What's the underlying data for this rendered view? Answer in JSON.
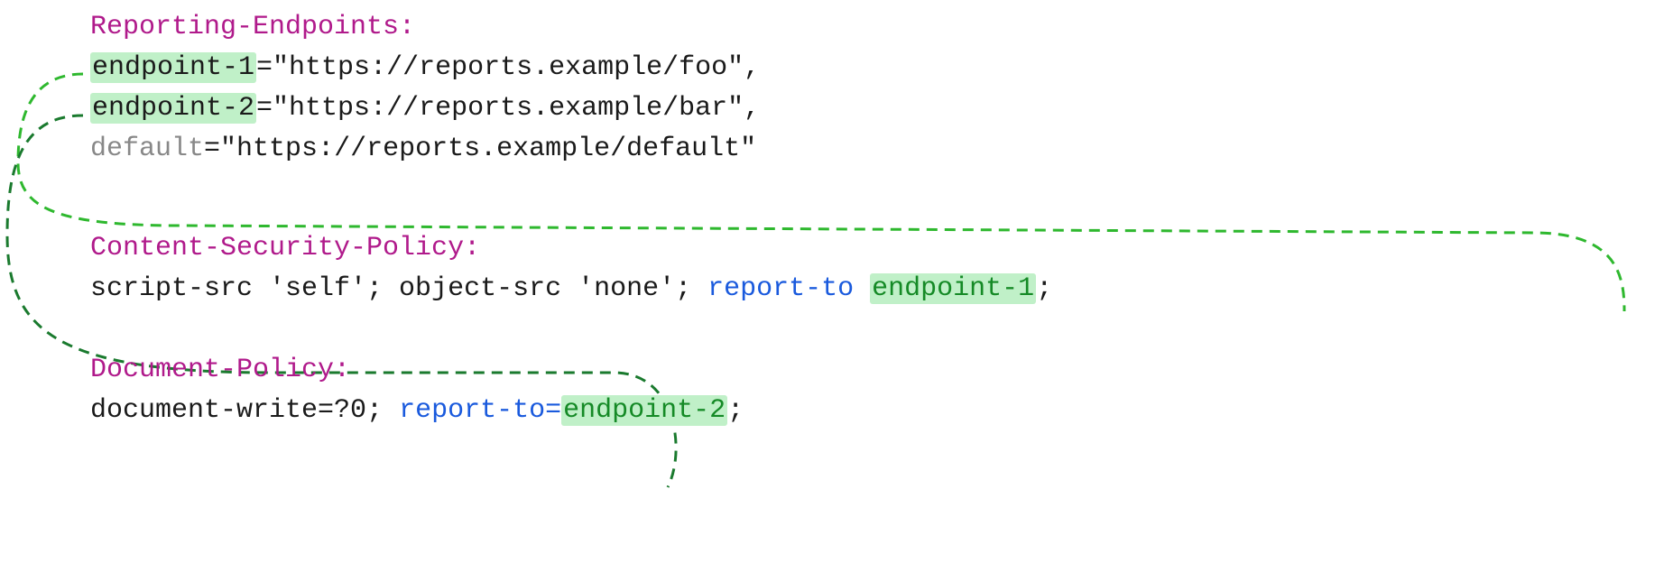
{
  "headers": {
    "reporting": {
      "name": "Reporting-Endpoints:",
      "endpoints": [
        {
          "key": "endpoint-1",
          "url": "\"https://reports.example/foo\"",
          "suffix": ","
        },
        {
          "key": "endpoint-2",
          "url": "\"https://reports.example/bar\"",
          "suffix": ","
        },
        {
          "key": "default",
          "url": "\"https://reports.example/default\"",
          "suffix": ""
        }
      ]
    },
    "csp": {
      "name": "Content-Security-Policy:",
      "value_prefix": "script-src 'self'; object-src 'none'; ",
      "report_to": "report-to ",
      "endpoint_ref": "endpoint-1",
      "suffix": ";"
    },
    "docpolicy": {
      "name": "Document-Policy:",
      "value_prefix": "document-write=?0; ",
      "report_to": "report-to=",
      "endpoint_ref": "endpoint-2",
      "suffix": ";"
    }
  }
}
